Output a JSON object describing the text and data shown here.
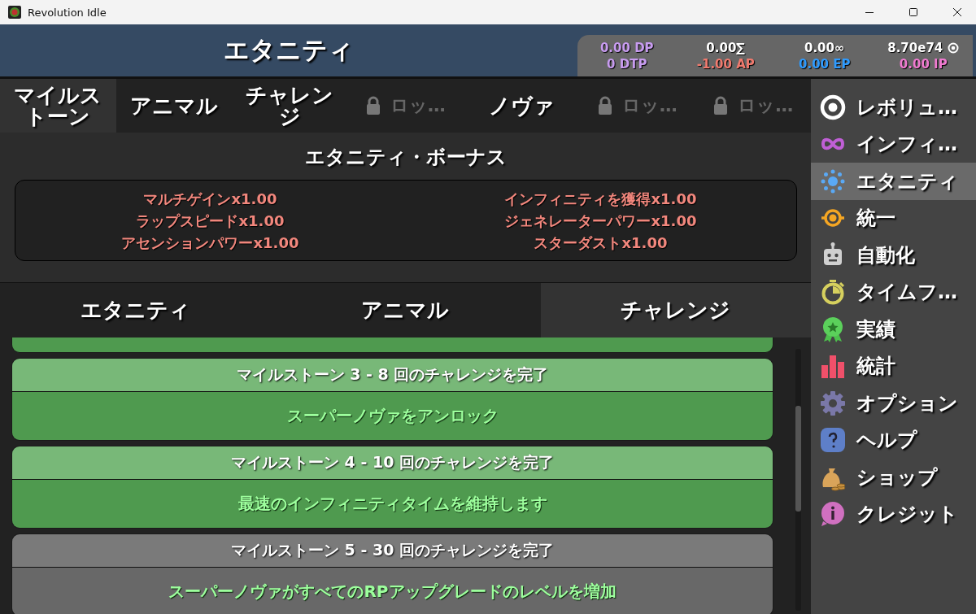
{
  "window": {
    "title": "Revolution Idle"
  },
  "header": {
    "title": "エタニティ"
  },
  "resources": [
    {
      "top": {
        "text": "0.00 DP",
        "color": "#c89cf0"
      },
      "bottom": {
        "text": "0 DTP",
        "color": "#c89cf0"
      }
    },
    {
      "top": {
        "text": "0.00∑",
        "color": "#ffffff"
      },
      "bottom": {
        "text": "-1.00 AP",
        "color": "#f07a6e"
      }
    },
    {
      "top": {
        "text": "0.00∞",
        "color": "#ffffff"
      },
      "bottom": {
        "text": "0.00 EP",
        "color": "#2e9bff"
      }
    },
    {
      "top": {
        "text": "8.70e74",
        "color": "#ffffff"
      },
      "bottom": {
        "text": "0.00 IP",
        "color": "#f07ad0"
      }
    }
  ],
  "tabs": [
    {
      "label": "マイルストーン",
      "selected": true,
      "locked": false
    },
    {
      "label": "アニマル",
      "selected": false,
      "locked": false
    },
    {
      "label": "チャレンジ",
      "selected": false,
      "locked": false
    },
    {
      "label": "ロッ…",
      "selected": false,
      "locked": true
    },
    {
      "label": "ノヴァ",
      "selected": false,
      "locked": false
    },
    {
      "label": "ロッ…",
      "selected": false,
      "locked": true
    },
    {
      "label": "ロッ…",
      "selected": false,
      "locked": true
    }
  ],
  "bonus": {
    "title": "エタニティ・ボーナス",
    "left": [
      "マルチゲインx1.00",
      "ラップスピードx1.00",
      "アセンションパワーx1.00"
    ],
    "right": [
      "インフィニティを獲得x1.00",
      "ジェネレーターパワーx1.00",
      "スターダストx1.00"
    ]
  },
  "subtabs": [
    {
      "label": "エタニティ",
      "selected": false
    },
    {
      "label": "アニマル",
      "selected": false
    },
    {
      "label": "チャレンジ",
      "selected": true
    }
  ],
  "milestones": [
    {
      "completed": true
    },
    {
      "title": "マイルストーン 3 - 8 回のチャレンジを完了",
      "reward": "スーパーノヴァをアンロック",
      "completed": true
    },
    {
      "title": "マイルストーン 4 - 10 回のチャレンジを完了",
      "reward": "最速のインフィニティタイムを維持します",
      "completed": true
    },
    {
      "title": "マイルストーン 5 - 30 回のチャレンジを完了",
      "reward": "スーパーノヴァがすべてのRPアップグレードのレベルを増加",
      "completed": false
    }
  ],
  "sidebar": {
    "items": [
      {
        "label": "レボリュ…",
        "selected": false
      },
      {
        "label": "インフィ…",
        "selected": false
      },
      {
        "label": "エタニティ",
        "selected": true
      },
      {
        "label": "統一",
        "selected": false
      },
      {
        "label": "自動化",
        "selected": false
      },
      {
        "label": "タイムフ…",
        "selected": false
      },
      {
        "label": "実績",
        "selected": false
      },
      {
        "label": "統計",
        "selected": false
      },
      {
        "label": "オプション",
        "selected": false
      },
      {
        "label": "ヘルプ",
        "selected": false
      },
      {
        "label": "ショップ",
        "selected": false
      },
      {
        "label": "クレジット",
        "selected": false
      }
    ]
  }
}
